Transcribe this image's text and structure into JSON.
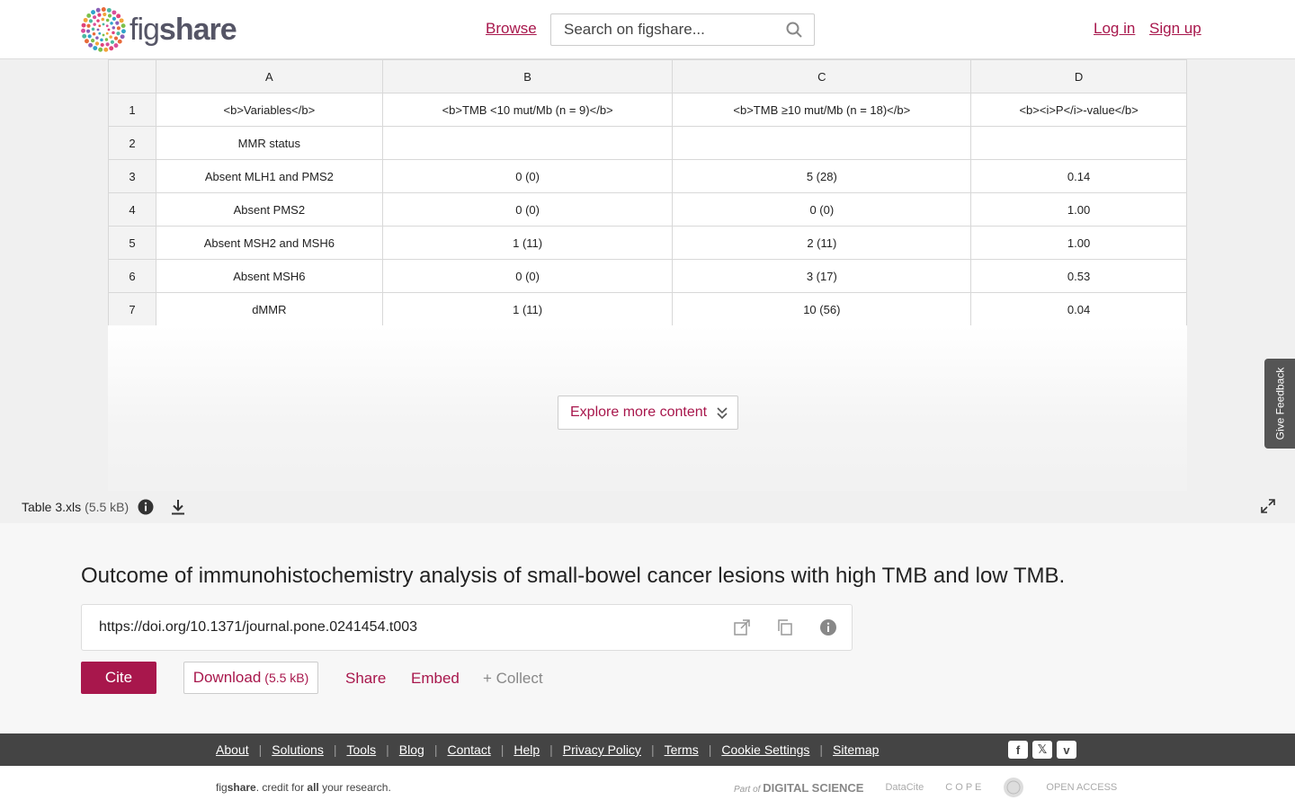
{
  "header": {
    "logo_text_light": "fig",
    "logo_text_bold": "share",
    "browse": "Browse",
    "search_placeholder": "Search on figshare...",
    "login": "Log in",
    "signup": "Sign up"
  },
  "sheet": {
    "columns": [
      "A",
      "B",
      "C",
      "D"
    ],
    "rows": [
      {
        "n": "1",
        "cells": [
          "<b>Variables</b>",
          "<b>TMB <10 mut/Mb (n = 9)</b>",
          "<b>TMB ≥10 mut/Mb (n = 18)</b>",
          "<b><i>P</i>-value</b>"
        ]
      },
      {
        "n": "2",
        "cells": [
          "MMR status",
          "",
          "",
          ""
        ]
      },
      {
        "n": "3",
        "cells": [
          "Absent MLH1 and PMS2",
          "0 (0)",
          "5 (28)",
          "0.14"
        ]
      },
      {
        "n": "4",
        "cells": [
          "Absent PMS2",
          "0 (0)",
          "0 (0)",
          "1.00"
        ]
      },
      {
        "n": "5",
        "cells": [
          "Absent MSH2 and MSH6",
          "1 (11)",
          "2 (11)",
          "1.00"
        ]
      },
      {
        "n": "6",
        "cells": [
          "Absent MSH6",
          "0 (0)",
          "3 (17)",
          "0.53"
        ]
      },
      {
        "n": "7",
        "cells": [
          "dMMR",
          "1 (11)",
          "10 (56)",
          "0.04"
        ]
      }
    ]
  },
  "preview": {
    "explore": "Explore more content",
    "file_name": "Table 3.xls",
    "file_size": "(5.5 kB)",
    "feedback": "Give Feedback"
  },
  "details": {
    "title": "Outcome of immunohistochemistry analysis of small-bowel cancer lesions with high TMB and low TMB.",
    "doi": "https://doi.org/10.1371/journal.pone.0241454.t003",
    "cite": "Cite",
    "download": "Download",
    "download_size": "(5.5 kB)",
    "share": "Share",
    "embed": "Embed",
    "collect": "+ Collect"
  },
  "footer": {
    "links": [
      "About",
      "Solutions",
      "Tools",
      "Blog",
      "Contact",
      "Help",
      "Privacy Policy",
      "Terms",
      "Cookie Settings",
      "Sitemap"
    ],
    "social": [
      {
        "icon": "facebook-icon",
        "glyph": "f"
      },
      {
        "icon": "x-icon",
        "glyph": "𝕏"
      },
      {
        "icon": "vimeo-icon",
        "glyph": "v"
      }
    ],
    "tagline_fig": "fig",
    "tagline_share": "share",
    "tagline_mid": ". credit for ",
    "tagline_all": "all",
    "tagline_end": " your research.",
    "partners": {
      "ds_prefix": "Part of",
      "ds_name": "DIGITAL SCIENCE",
      "datacite": "DataCite",
      "cope": "C O P E",
      "open_access": "OPEN ACCESS"
    }
  },
  "colors": {
    "brand": "#a8174c",
    "footer_bg": "#444444"
  }
}
